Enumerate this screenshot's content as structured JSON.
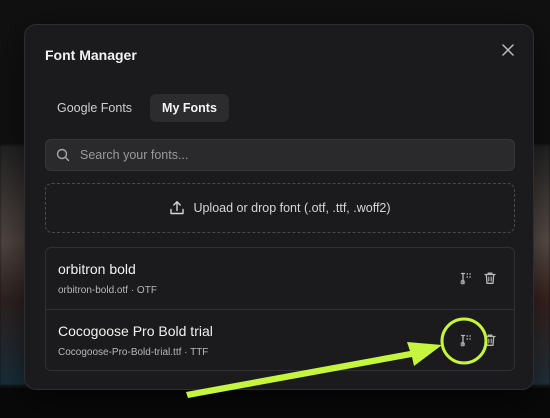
{
  "modal": {
    "title": "Font Manager"
  },
  "tabs": [
    {
      "label": "Google Fonts",
      "active": false
    },
    {
      "label": "My Fonts",
      "active": true
    }
  ],
  "search": {
    "placeholder": "Search your fonts..."
  },
  "upload": {
    "label": "Upload or drop font (.otf, .ttf, .woff2)"
  },
  "fonts": [
    {
      "name": "orbitron bold",
      "meta": "orbitron-bold.otf · OTF"
    },
    {
      "name": "Cocogoose Pro Bold trial",
      "meta": "Cocogoose-Pro-Bold-trial.ttf · TTF"
    }
  ],
  "icons": {
    "close": "close-icon",
    "search": "search-icon",
    "upload": "upload-icon",
    "rename": "rename-icon",
    "delete": "trash-icon"
  },
  "colors": {
    "highlight": "#c6f53f"
  }
}
